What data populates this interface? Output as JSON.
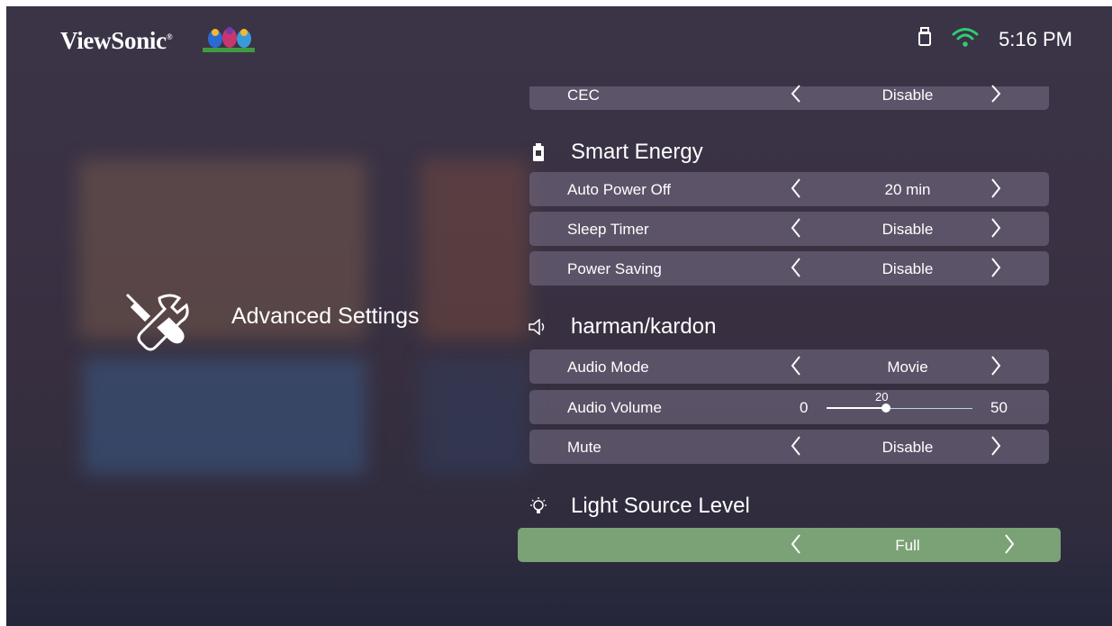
{
  "brand": {
    "name": "ViewSonic",
    "mark": "®"
  },
  "status_bar": {
    "time": "5:16 PM",
    "icons": [
      "usb-drive-icon",
      "wifi-icon"
    ]
  },
  "sidebar": {
    "title": "Advanced Settings",
    "icon": "wrench-screwdriver-icon"
  },
  "menu": {
    "cec": {
      "label": "CEC",
      "value": "Disable"
    },
    "smart_energy": {
      "heading": "Smart Energy",
      "icon": "battery-icon",
      "rows": [
        {
          "label": "Auto Power Off",
          "value": "20 min"
        },
        {
          "label": "Sleep Timer",
          "value": "Disable"
        },
        {
          "label": "Power Saving",
          "value": "Disable"
        }
      ]
    },
    "audio": {
      "heading": "harman/kardon",
      "icon": "speaker-icon",
      "audio_mode": {
        "label": "Audio Mode",
        "value": "Movie"
      },
      "audio_volume": {
        "label": "Audio Volume",
        "min": "0",
        "max": "50",
        "current": "20"
      },
      "mute": {
        "label": "Mute",
        "value": "Disable"
      }
    },
    "light_source": {
      "heading": "Light Source Level",
      "icon": "lightbulb-icon",
      "value": "Full"
    }
  },
  "colors": {
    "selected_row": "#7aa276",
    "row_bg": "#6f6580",
    "accent_wifi": "#2ecc71",
    "slider": "#bcd2e6"
  }
}
